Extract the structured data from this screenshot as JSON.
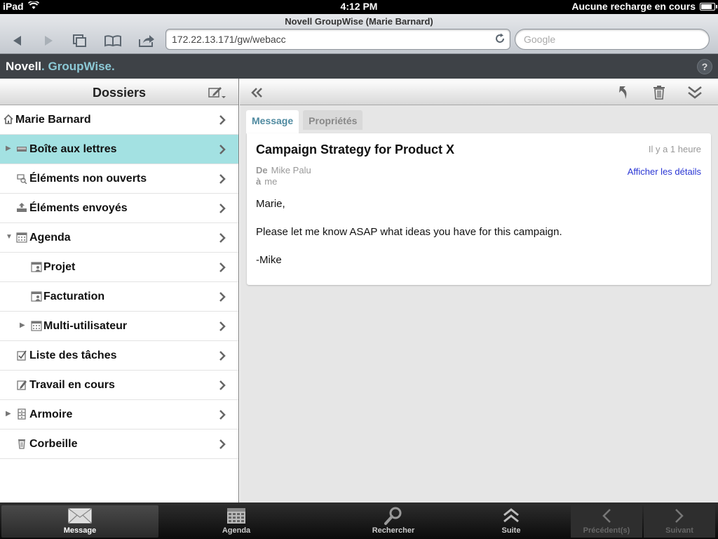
{
  "status_bar": {
    "device": "iPad",
    "time": "4:12 PM",
    "charging": "Aucune recharge en cours",
    "battery_level": 0.9
  },
  "browser": {
    "page_title": "Novell GroupWise (Marie Barnard)",
    "url": "172.22.13.171/gw/webacc",
    "search_placeholder": "Google"
  },
  "app": {
    "brand_novell": "Novell",
    "brand_groupwise": "GroupWise",
    "help_label": "?"
  },
  "sidebar": {
    "title": "Dossiers",
    "items": [
      {
        "label": "Marie Barnard",
        "icon": "home-icon",
        "level": 0,
        "disclosure": "",
        "selected": false
      },
      {
        "label": "Boîte aux lettres",
        "icon": "mailbox-icon",
        "level": 0,
        "disclosure": "▶",
        "selected": true
      },
      {
        "label": "Éléments non ouverts",
        "icon": "unopened-icon",
        "level": 0,
        "disclosure": "",
        "selected": false
      },
      {
        "label": "Éléments envoyés",
        "icon": "sent-icon",
        "level": 0,
        "disclosure": "",
        "selected": false
      },
      {
        "label": "Agenda",
        "icon": "calendar-icon",
        "level": 0,
        "disclosure": "▼",
        "selected": false
      },
      {
        "label": "Projet",
        "icon": "shared-calendar-icon",
        "level": 1,
        "disclosure": "",
        "selected": false
      },
      {
        "label": "Facturation",
        "icon": "shared-calendar-icon",
        "level": 1,
        "disclosure": "",
        "selected": false
      },
      {
        "label": "Multi-utilisateur",
        "icon": "calendar-icon",
        "level": 1,
        "disclosure": "▶",
        "selected": false
      },
      {
        "label": "Liste des tâches",
        "icon": "tasklist-icon",
        "level": 0,
        "disclosure": "",
        "selected": false
      },
      {
        "label": "Travail en cours",
        "icon": "work-in-progress-icon",
        "level": 0,
        "disclosure": "",
        "selected": false
      },
      {
        "label": "Armoire",
        "icon": "cabinet-icon",
        "level": 0,
        "disclosure": "▶",
        "selected": false
      },
      {
        "label": "Corbeille",
        "icon": "trash-icon",
        "level": 0,
        "disclosure": "",
        "selected": false
      }
    ]
  },
  "message": {
    "tabs": [
      "Message",
      "Propriétés"
    ],
    "subject": "Campaign Strategy for Product X",
    "time": "Il y a 1 heure",
    "from_label": "De",
    "from": "Mike Palu",
    "to_label": "à",
    "to": "me",
    "details_link": "Afficher les détails",
    "body": [
      "Marie,",
      "Please let me know ASAP what ideas you have for this campaign.",
      "-Mike"
    ]
  },
  "tabbar": {
    "items": [
      {
        "label": "Message",
        "icon": "envelope-icon",
        "state": "active"
      },
      {
        "label": "Agenda",
        "icon": "calendar-grid-icon",
        "state": "normal"
      },
      {
        "label": "Rechercher",
        "icon": "magnifier-icon",
        "state": "normal"
      },
      {
        "label": "Suite",
        "icon": "double-chevron-up-icon",
        "state": "normal"
      },
      {
        "label": "Précédent(s)",
        "icon": "chevron-left-icon",
        "state": "disabled"
      },
      {
        "label": "Suivant",
        "icon": "chevron-right-icon",
        "state": "disabled"
      }
    ]
  },
  "colors": {
    "selected_row": "#a3e1e2",
    "brand_accent": "#8cc9d6",
    "link": "#2a36d4",
    "active_tab_text": "#4f8aa0"
  }
}
